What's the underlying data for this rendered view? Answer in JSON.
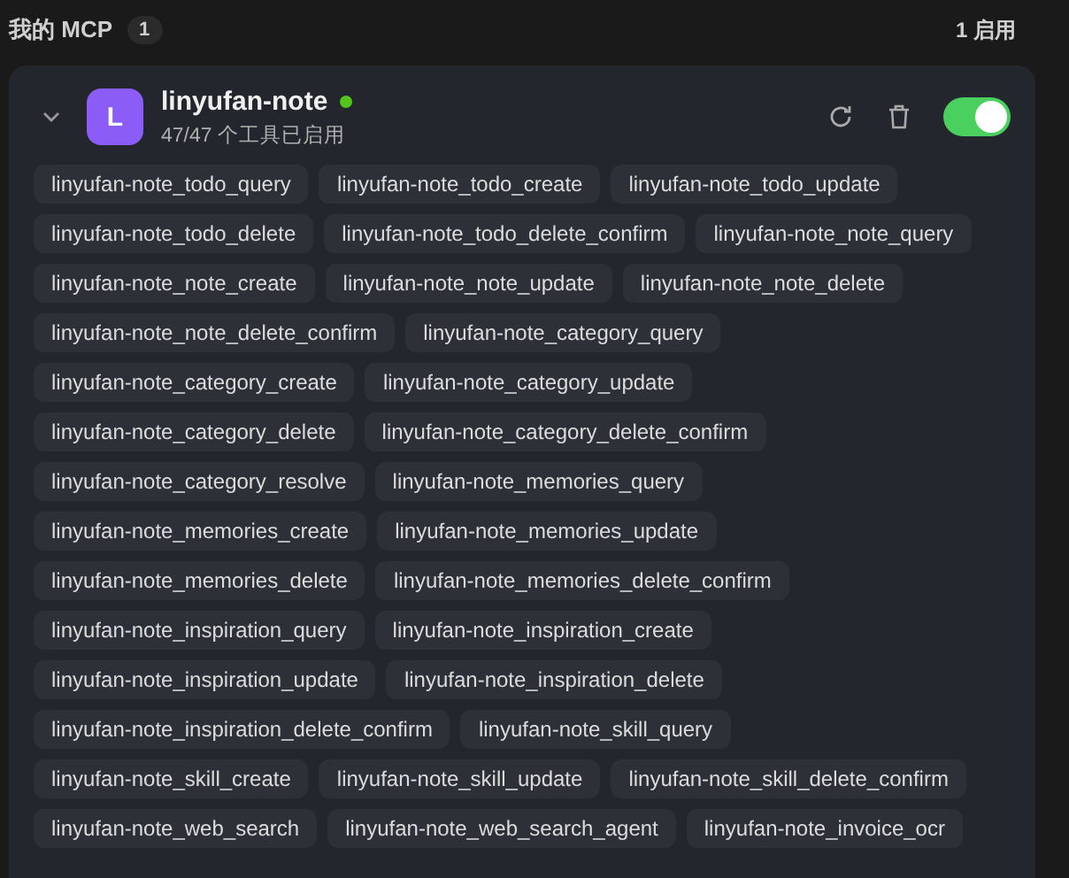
{
  "section": {
    "title": "我的 MCP",
    "count": "1",
    "enabled_summary": "1 启用"
  },
  "server": {
    "avatar": "L",
    "name": "linyufan-note",
    "online": true,
    "subtitle": "47/47 个工具已启用",
    "expanded": true,
    "enabled": true,
    "tools": [
      "linyufan-note_todo_query",
      "linyufan-note_todo_create",
      "linyufan-note_todo_update",
      "linyufan-note_todo_delete",
      "linyufan-note_todo_delete_confirm",
      "linyufan-note_note_query",
      "linyufan-note_note_create",
      "linyufan-note_note_update",
      "linyufan-note_note_delete",
      "linyufan-note_note_delete_confirm",
      "linyufan-note_category_query",
      "linyufan-note_category_create",
      "linyufan-note_category_update",
      "linyufan-note_category_delete",
      "linyufan-note_category_delete_confirm",
      "linyufan-note_category_resolve",
      "linyufan-note_memories_query",
      "linyufan-note_memories_create",
      "linyufan-note_memories_update",
      "linyufan-note_memories_delete",
      "linyufan-note_memories_delete_confirm",
      "linyufan-note_inspiration_query",
      "linyufan-note_inspiration_create",
      "linyufan-note_inspiration_update",
      "linyufan-note_inspiration_delete",
      "linyufan-note_inspiration_delete_confirm",
      "linyufan-note_skill_query",
      "linyufan-note_skill_create",
      "linyufan-note_skill_update",
      "linyufan-note_skill_delete_confirm",
      "linyufan-note_web_search",
      "linyufan-note_web_search_agent",
      "linyufan-note_invoice_ocr"
    ]
  }
}
